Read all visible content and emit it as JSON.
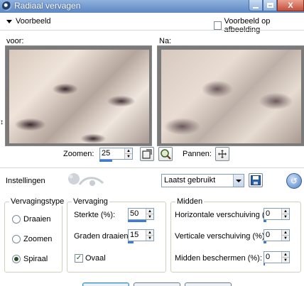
{
  "window": {
    "title": "Radiaal vervagen",
    "close_label": "X"
  },
  "preview_header": {
    "toggle_label": "Voorbeeld",
    "preview_on_image_label": "Voorbeeld op afbeelding",
    "preview_on_image_checked": false
  },
  "previews": {
    "before_label": "voor:",
    "after_label": "Na:"
  },
  "zoom": {
    "label": "Zoomen:",
    "value": "25",
    "pan_label": "Pannen:"
  },
  "settings": {
    "label": "Instellingen",
    "preset_value": "Laatst gebruikt"
  },
  "blur_type": {
    "title": "Vervagingstype",
    "options": [
      "Draaien",
      "Zoomen",
      "Spiraal"
    ],
    "selected": "Spiraal"
  },
  "blur": {
    "title": "Vervaging",
    "strength_label": "Sterkte (%):",
    "strength_value": "50",
    "rotate_label": "Graden draaien:",
    "rotate_value": "15",
    "oval_label": "Ovaal",
    "oval_checked": true
  },
  "center": {
    "title": "Midden",
    "hshift_label": "Horizontale verschuiving (%):",
    "hshift_value": "0",
    "vshift_label": "Verticale verschuiving (%):",
    "vshift_value": "0",
    "protect_label": "Midden beschermen (%):",
    "protect_value": "0"
  },
  "colors": {
    "titlebar": "#6a90c8",
    "accent_bar": "#3d7bd8"
  }
}
